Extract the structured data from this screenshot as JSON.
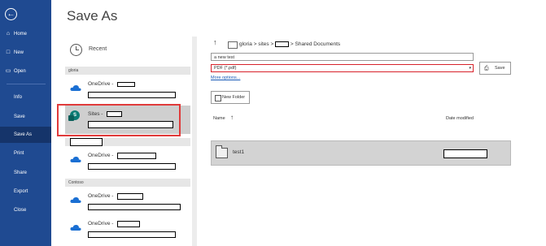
{
  "nav": {
    "back_icon": "back-arrow-icon",
    "items": [
      {
        "label": "Home",
        "icon": "home-icon"
      },
      {
        "label": "New",
        "icon": "new-doc-icon"
      },
      {
        "label": "Open",
        "icon": "open-folder-icon"
      },
      {
        "label": "Info"
      },
      {
        "label": "Save"
      },
      {
        "label": "Save As"
      },
      {
        "label": "Print"
      },
      {
        "label": "Share"
      },
      {
        "label": "Export"
      },
      {
        "label": "Close"
      }
    ],
    "active": "Save As",
    "background": "#1f4a91"
  },
  "page_title": "Save As",
  "locations": {
    "recent": "Recent",
    "groups": [
      {
        "header": "gloria",
        "items": [
          {
            "label": "OneDrive - "
          },
          {
            "label": "Sites - "
          }
        ]
      },
      {
        "header": "",
        "items": [
          {
            "label": "OneDrive - "
          }
        ]
      },
      {
        "header": "Contoso",
        "items": [
          {
            "label": "OneDrive - "
          },
          {
            "label": "OneDrive - "
          }
        ]
      }
    ]
  },
  "path": {
    "prefix": "gloria > sites >",
    "suffix": "> Shared Documents"
  },
  "filename": "a new test",
  "filetype": "PDF (*.pdf)",
  "more_options": "More options...",
  "save_button": "Save",
  "new_folder_button": "New Folder",
  "columns": {
    "name": "Name",
    "date": "Date modified"
  },
  "files": [
    {
      "name": "test1"
    }
  ],
  "colors": {
    "highlight": "#e03a3a",
    "filetype_border": "#d8222a",
    "link": "#1a5bb7"
  }
}
